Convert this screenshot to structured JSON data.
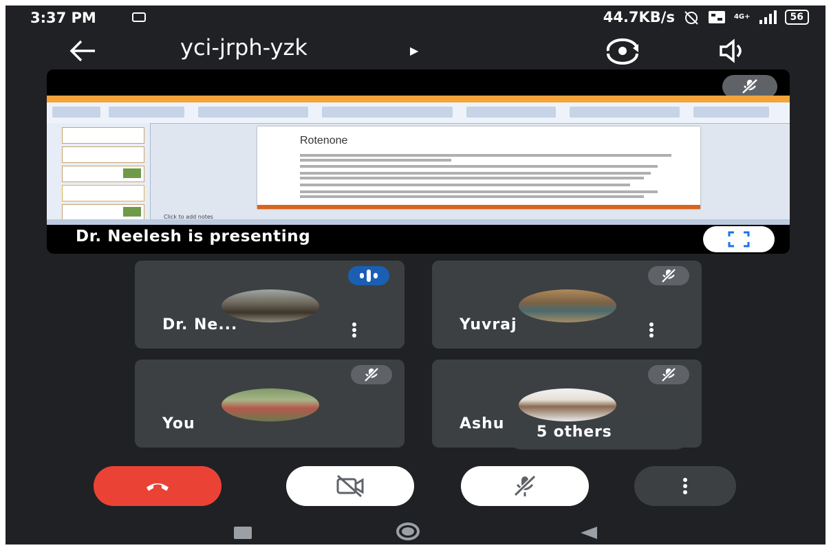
{
  "status_bar": {
    "time": "3:37 PM",
    "network_speed": "44.7KB/s",
    "signal_label": "4G+",
    "battery": "56"
  },
  "meeting": {
    "code": "yci-jrph-yzk",
    "back_icon": "arrow-left-icon",
    "switch_camera_icon": "switch-camera-icon",
    "audio_icon": "speaker-icon"
  },
  "presentation": {
    "label": "Dr. Neelesh is presenting",
    "slide_title": "Rotenone",
    "notes_text": "Click to add notes",
    "fullscreen_icon": "fullscreen-icon",
    "muted_icon": "mic-off-icon"
  },
  "participants": [
    {
      "name": "Dr. Ne...",
      "speaking": true
    },
    {
      "name": "Yuvraj",
      "speaking": false
    },
    {
      "name": "You",
      "speaking": false
    },
    {
      "name": "Ashu",
      "speaking": false
    }
  ],
  "others_badge": "5 others",
  "controls": {
    "end_call": "end-call-icon",
    "camera": "camera-off-icon",
    "mic": "mic-off-icon",
    "more": "more-vert-icon"
  },
  "nav": {
    "recents": "recents-icon",
    "home": "home-icon",
    "back": "back-icon"
  },
  "colors": {
    "background": "#202124",
    "tile": "#3c4043",
    "end_call": "#ea4335",
    "speaking": "#1a5fb4"
  }
}
